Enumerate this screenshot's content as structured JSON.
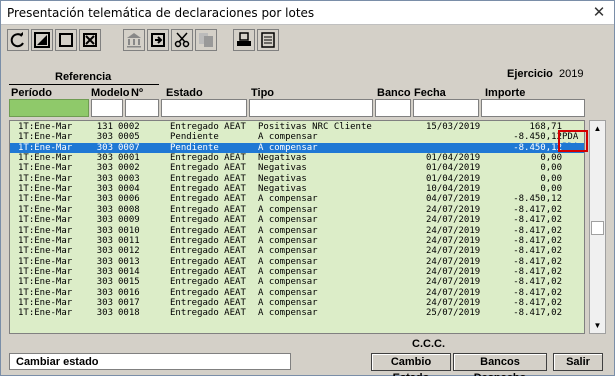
{
  "window": {
    "title": "Presentación telemática de declaraciones por lotes",
    "close_glyph": "✕"
  },
  "toolbar": {
    "icons": [
      "refresh-icon",
      "edit-icon",
      "select-icon",
      "delete-icon",
      "bank-icon",
      "export-icon",
      "cut-icon",
      "copy-icon",
      "print-icon",
      "list-icon"
    ]
  },
  "header": {
    "referencia": "Referencia",
    "ejercicio_label": "Ejercicio",
    "ejercicio_value": "2019",
    "columns": {
      "periodo": "Período",
      "modelo": "Modelo",
      "numero": "Nº",
      "estado": "Estado",
      "tipo": "Tipo",
      "banco": "Banco",
      "fecha": "Fecha",
      "importe": "Importe"
    }
  },
  "rows": [
    {
      "periodo": "1T:Ene-Mar",
      "modelo": "131",
      "numero": "0002",
      "estado": "Entregado AEAT",
      "tipo": "Positivas NRC Cliente",
      "fecha": "15/03/2019",
      "importe": "168,71"
    },
    {
      "periodo": "1T:Ene-Mar",
      "modelo": "303",
      "numero": "0005",
      "estado": "Pendiente",
      "tipo": "A compensar",
      "fecha": "",
      "importe": "-8.450,12"
    },
    {
      "periodo": "1T:Ene-Mar",
      "modelo": "303",
      "numero": "0007",
      "estado": "Pendiente",
      "tipo": "A compensar",
      "fecha": "",
      "importe": "-8.450,12",
      "selected": true
    },
    {
      "periodo": "1T:Ene-Mar",
      "modelo": "303",
      "numero": "0001",
      "estado": "Entregado AEAT",
      "tipo": "Negativas",
      "fecha": "01/04/2019",
      "importe": "0,00"
    },
    {
      "periodo": "1T:Ene-Mar",
      "modelo": "303",
      "numero": "0002",
      "estado": "Entregado AEAT",
      "tipo": "Negativas",
      "fecha": "01/04/2019",
      "importe": "0,00"
    },
    {
      "periodo": "1T:Ene-Mar",
      "modelo": "303",
      "numero": "0003",
      "estado": "Entregado AEAT",
      "tipo": "Negativas",
      "fecha": "01/04/2019",
      "importe": "0,00"
    },
    {
      "periodo": "1T:Ene-Mar",
      "modelo": "303",
      "numero": "0004",
      "estado": "Entregado AEAT",
      "tipo": "Negativas",
      "fecha": "10/04/2019",
      "importe": "0,00"
    },
    {
      "periodo": "1T:Ene-Mar",
      "modelo": "303",
      "numero": "0006",
      "estado": "Entregado AEAT",
      "tipo": "A compensar",
      "fecha": "04/07/2019",
      "importe": "-8.450,12"
    },
    {
      "periodo": "1T:Ene-Mar",
      "modelo": "303",
      "numero": "0008",
      "estado": "Entregado AEAT",
      "tipo": "A compensar",
      "fecha": "24/07/2019",
      "importe": "-8.417,02"
    },
    {
      "periodo": "1T:Ene-Mar",
      "modelo": "303",
      "numero": "0009",
      "estado": "Entregado AEAT",
      "tipo": "A compensar",
      "fecha": "24/07/2019",
      "importe": "-8.417,02"
    },
    {
      "periodo": "1T:Ene-Mar",
      "modelo": "303",
      "numero": "0010",
      "estado": "Entregado AEAT",
      "tipo": "A compensar",
      "fecha": "24/07/2019",
      "importe": "-8.417,02"
    },
    {
      "periodo": "1T:Ene-Mar",
      "modelo": "303",
      "numero": "0011",
      "estado": "Entregado AEAT",
      "tipo": "A compensar",
      "fecha": "24/07/2019",
      "importe": "-8.417,02"
    },
    {
      "periodo": "1T:Ene-Mar",
      "modelo": "303",
      "numero": "0012",
      "estado": "Entregado AEAT",
      "tipo": "A compensar",
      "fecha": "24/07/2019",
      "importe": "-8.417,02"
    },
    {
      "periodo": "1T:Ene-Mar",
      "modelo": "303",
      "numero": "0013",
      "estado": "Entregado AEAT",
      "tipo": "A compensar",
      "fecha": "24/07/2019",
      "importe": "-8.417,02"
    },
    {
      "periodo": "1T:Ene-Mar",
      "modelo": "303",
      "numero": "0014",
      "estado": "Entregado AEAT",
      "tipo": "A compensar",
      "fecha": "24/07/2019",
      "importe": "-8.417,02"
    },
    {
      "periodo": "1T:Ene-Mar",
      "modelo": "303",
      "numero": "0015",
      "estado": "Entregado AEAT",
      "tipo": "A compensar",
      "fecha": "24/07/2019",
      "importe": "-8.417,02"
    },
    {
      "periodo": "1T:Ene-Mar",
      "modelo": "303",
      "numero": "0016",
      "estado": "Entregado AEAT",
      "tipo": "A compensar",
      "fecha": "24/07/2019",
      "importe": "-8.417,02"
    },
    {
      "periodo": "1T:Ene-Mar",
      "modelo": "303",
      "numero": "0017",
      "estado": "Entregado AEAT",
      "tipo": "A compensar",
      "fecha": "24/07/2019",
      "importe": "-8.417,02"
    },
    {
      "periodo": "1T:Ene-Mar",
      "modelo": "303",
      "numero": "0018",
      "estado": "Entregado AEAT",
      "tipo": "A compensar",
      "fecha": "25/07/2019",
      "importe": "-8.417,02"
    }
  ],
  "pda_labels": [
    "PDA",
    "PDA"
  ],
  "footer": {
    "ccc_label": "C.C.C.",
    "status_text": "Cambiar estado",
    "btn_cambio": "Cambio Estado",
    "btn_bancos": "Bancos Despacho",
    "btn_salir": "Salir"
  },
  "colors": {
    "grid_bg": "#dcedc8",
    "selected_row": "#1f78d4",
    "highlight_box": "#d40000",
    "filter_green": "#8fc96a"
  }
}
